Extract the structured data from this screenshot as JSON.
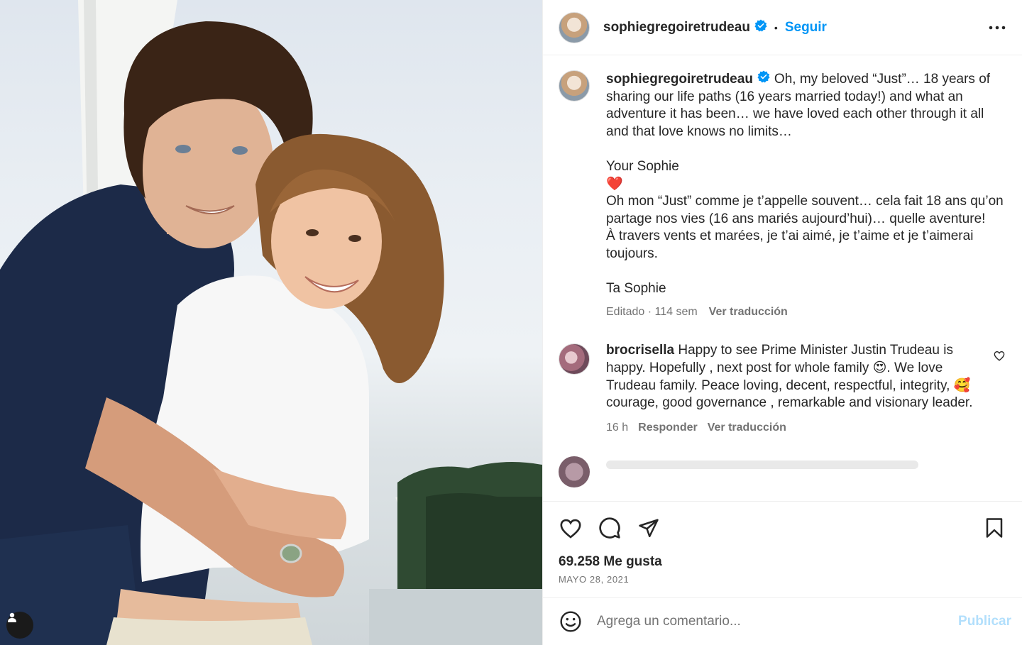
{
  "post": {
    "username": "sophiegregoiretrudeau",
    "separator": "•",
    "follow_label": "Seguir",
    "more_icon": "more-horizontal-icon"
  },
  "caption": {
    "username": "sophiegregoiretrudeau",
    "text": "Oh, my beloved “Just”… 18 years of sharing our life paths (16 years married today!) and what an adventure it has been… we have loved each other through it all and that love knows no limits…\n\nYour Sophie\n❤️\nOh mon “Just” comme je t’appelle souvent… cela fait 18 ans qu’on partage nos vies (16 ans mariés aujourd’hui)… quelle aventure!\nÀ travers vents et marées, je t’ai aimé, je t’aime et je t’aimerai toujours.\n\nTa Sophie",
    "edited_time": "Editado · 114 sem",
    "translate_label": "Ver traducción"
  },
  "comments": [
    {
      "username": "brocrisella",
      "text": "Happy to see Prime Minister Justin Trudeau is happy. Hopefully , next post for whole family 😍. We love Trudeau family. Peace loving, decent, respectful, integrity, 🥰 courage, good governance , remarkable and visionary leader.",
      "time": "16 h",
      "reply_label": "Responder",
      "translate_label": "Ver traducción"
    }
  ],
  "actions": {
    "likes": "69.258 Me gusta",
    "date": "MAYO 28, 2021"
  },
  "add_comment": {
    "placeholder": "Agrega un comentario...",
    "publish_label": "Publicar"
  },
  "colors": {
    "link_blue": "#0095f6",
    "publish_disabled": "#b2dffc",
    "secondary_text": "#737373",
    "verified_badge": "#0095f6"
  }
}
